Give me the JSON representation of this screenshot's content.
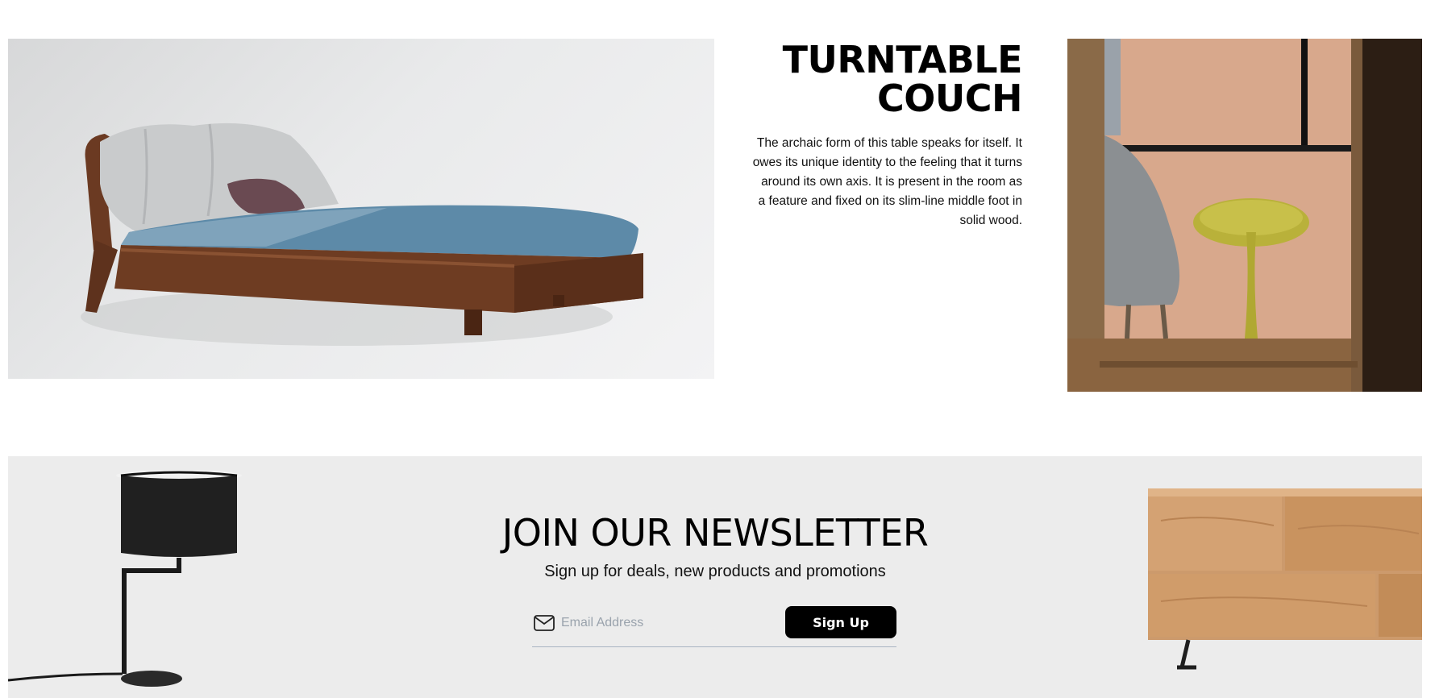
{
  "product": {
    "title_line1": "TURNTABLE",
    "title_line2": "COUCH",
    "description": "The archaic form of this table speaks for itself. It owes its unique identity to the feeling that it turns around its own axis. It is present in the room as a feature and fixed on its slim-line middle foot in solid wood.",
    "images": [
      "bed-photo",
      "turntable-table-photo"
    ]
  },
  "newsletter": {
    "title": "JOIN OUR NEWSLETTER",
    "subtitle": "Sign up for deals, new products and promotions",
    "email_placeholder": "Email Address",
    "email_value": "",
    "signup_label": "Sign Up",
    "icon": "mail-icon",
    "images": [
      "lamp-image",
      "sideboard-image"
    ]
  },
  "colors": {
    "page_bg": "#ffffff",
    "newsletter_bg": "#ececec",
    "button_bg": "#000000",
    "button_text": "#ffffff",
    "input_underline": "#a9b4c2"
  }
}
